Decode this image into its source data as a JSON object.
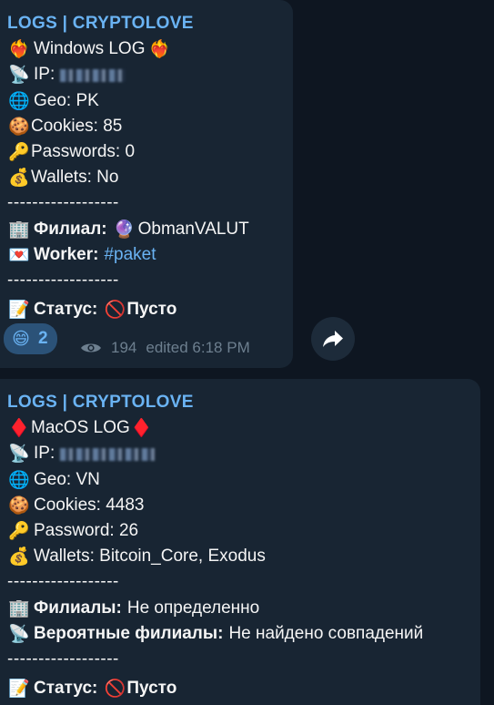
{
  "message1": {
    "sender": "LOGS | CRYPTOLOVE",
    "lines": [
      {
        "emoji": "❤️‍🔥",
        "text": "Windows LOG",
        "emoji_after": "❤️‍🔥"
      },
      {
        "emoji": "📡",
        "text": "IP:"
      },
      {
        "emoji": "🌐",
        "text": "Geo: PK"
      },
      {
        "emoji": "🍪",
        "text": "Cookies: 85"
      },
      {
        "emoji": "🔑",
        "text": "Passwords: 0"
      },
      {
        "emoji": "💰",
        "text": "Wallets: No"
      }
    ],
    "separator": "------------------",
    "branch": {
      "emoji": "🏢",
      "label": "Филиал:",
      "emoji2": "🔮",
      "value": "ObmanVALUT"
    },
    "worker": {
      "emoji": "💌",
      "label": "Worker:",
      "value": "#paket"
    },
    "status": {
      "emoji": "📝",
      "label": "Статус:",
      "emoji2": "🚫",
      "value": "Пусто"
    },
    "reaction": {
      "emoji": "😄",
      "count": "2"
    },
    "views": "194",
    "edited": "edited 6:18 PM"
  },
  "message2": {
    "sender": "LOGS | CRYPTOLOVE",
    "lines": [
      {
        "emoji": "♦️",
        "text": "MacOS LOG",
        "emoji_after": "♦️"
      },
      {
        "emoji": "📡",
        "text": "IP:"
      },
      {
        "emoji": "🌐",
        "text": "Geo: VN"
      },
      {
        "emoji": "🍪",
        "text": "Cookies: 4483"
      },
      {
        "emoji": "🔑",
        "text": "Password: 26"
      },
      {
        "emoji": "💰",
        "text": "Wallets: Bitcoin_Core, Exodus"
      }
    ],
    "separator": "------------------",
    "branches": {
      "emoji": "🏢",
      "label": "Филиалы:",
      "value": "Не определенно"
    },
    "probable_branches": {
      "emoji": "📡",
      "label": "Вероятные филиалы:",
      "value": "Не найдено совпадений"
    },
    "status": {
      "emoji": "📝",
      "label": "Статус:",
      "emoji2": "🚫",
      "value": "Пусто"
    }
  },
  "icons": {
    "eye": "eye-icon",
    "forward": "forward-arrow-icon"
  },
  "colors": {
    "background": "#0e1621",
    "bubble": "#182533",
    "accent": "#6ab3f3",
    "muted": "#6d7f8f"
  }
}
